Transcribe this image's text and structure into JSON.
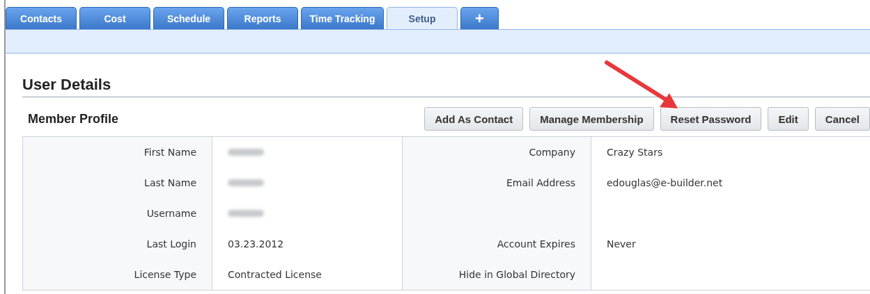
{
  "tabs": [
    {
      "label": "Contacts",
      "selected": false
    },
    {
      "label": "Cost",
      "selected": false
    },
    {
      "label": "Schedule",
      "selected": false
    },
    {
      "label": "Reports",
      "selected": false
    },
    {
      "label": "Time Tracking",
      "selected": false
    },
    {
      "label": "Setup",
      "selected": true
    },
    {
      "label": "+",
      "selected": false
    }
  ],
  "page_title": "User Details",
  "section_title": "Member Profile",
  "buttons": [
    "Add As Contact",
    "Manage Membership",
    "Reset Password",
    "Edit",
    "Cancel"
  ],
  "callout": {
    "kind": "arrow"
  },
  "rows": [
    {
      "left": {
        "label": "First Name",
        "redacted": true
      },
      "right": {
        "label": "Company",
        "value": "Crazy Stars"
      }
    },
    {
      "left": {
        "label": "Last Name",
        "redacted": true
      },
      "right": {
        "label": "Email Address",
        "value": "edouglas@e-builder.net"
      }
    },
    {
      "left": {
        "label": "Username",
        "redacted": true
      },
      "right": {}
    },
    {
      "left": {
        "label": "Last Login",
        "value": "03.23.2012"
      },
      "right": {
        "label": "Account Expires",
        "value": "Never"
      }
    },
    {
      "left": {
        "label": "License Type",
        "value": "Contracted License"
      },
      "right": {
        "label": "Hide in Global Directory"
      }
    }
  ]
}
